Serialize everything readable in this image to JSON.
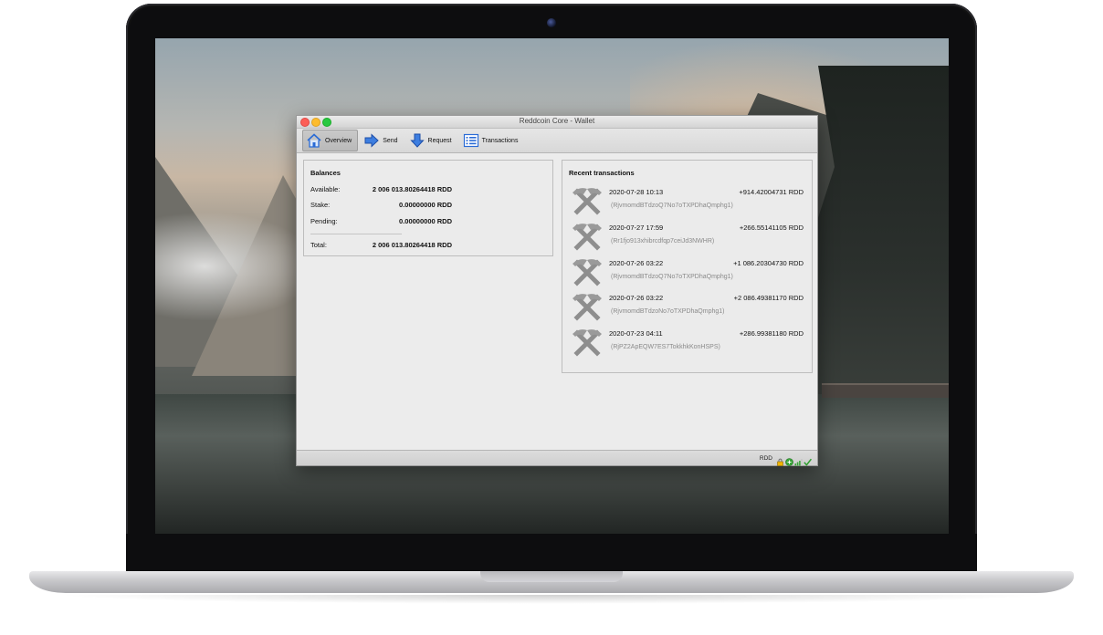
{
  "window": {
    "title": "Reddcoin Core - Wallet"
  },
  "toolbar": {
    "items": [
      {
        "label": "Overview",
        "icon": "home-icon",
        "active": true
      },
      {
        "label": "Send",
        "icon": "send-arrow-icon",
        "active": false
      },
      {
        "label": "Request",
        "icon": "receive-arrow-icon",
        "active": false
      },
      {
        "label": "Transactions",
        "icon": "list-icon",
        "active": false
      }
    ]
  },
  "balances": {
    "title": "Balances",
    "available_label": "Available:",
    "available_value": "2 006 013.80264418 RDD",
    "stake_label": "Stake:",
    "stake_value": "0.00000000 RDD",
    "pending_label": "Pending:",
    "pending_value": "0.00000000 RDD",
    "total_label": "Total:",
    "total_value": "2 006 013.80264418 RDD"
  },
  "recent": {
    "title": "Recent transactions",
    "items": [
      {
        "date": "2020-07-28 10:13",
        "amount": "+914.42004731 RDD",
        "address": "(RjvmomdBTdzoQ7No7oTXPDhaQmphg1)",
        "icon": "mined-pickaxe-icon"
      },
      {
        "date": "2020-07-27 17:59",
        "amount": "+266.55141105 RDD",
        "address": "(Rr1fjo913xhibrcdfqp7ceiJd3NWHR)",
        "icon": "mined-pickaxe-icon"
      },
      {
        "date": "2020-07-26 03:22",
        "amount": "+1 086.20304730 RDD",
        "address": "(RjvmomdBTdzoQ7No7oTXPDhaQmphg1)",
        "icon": "mined-pickaxe-icon"
      },
      {
        "date": "2020-07-26 03:22",
        "amount": "+2 086.49381170 RDD",
        "address": "(RjvmomdBTdzoNo7oTXPDhaQmphg1)",
        "icon": "mined-pickaxe-icon"
      },
      {
        "date": "2020-07-23 04:11",
        "amount": "+286.99381180 RDD",
        "address": "(RjPZ2ApEQW7ES7TokkhkKonHSPS)",
        "icon": "mined-pickaxe-icon"
      }
    ]
  },
  "statusbar": {
    "unit": "RDD",
    "icons": [
      "lock-icon",
      "staking-icon",
      "signal-bars-icon",
      "synced-check-icon"
    ]
  },
  "colors": {
    "close": "#fc5f57",
    "minimize": "#fdbc2e",
    "maximize": "#28c840",
    "accent_blue": "#2a6bd6"
  }
}
